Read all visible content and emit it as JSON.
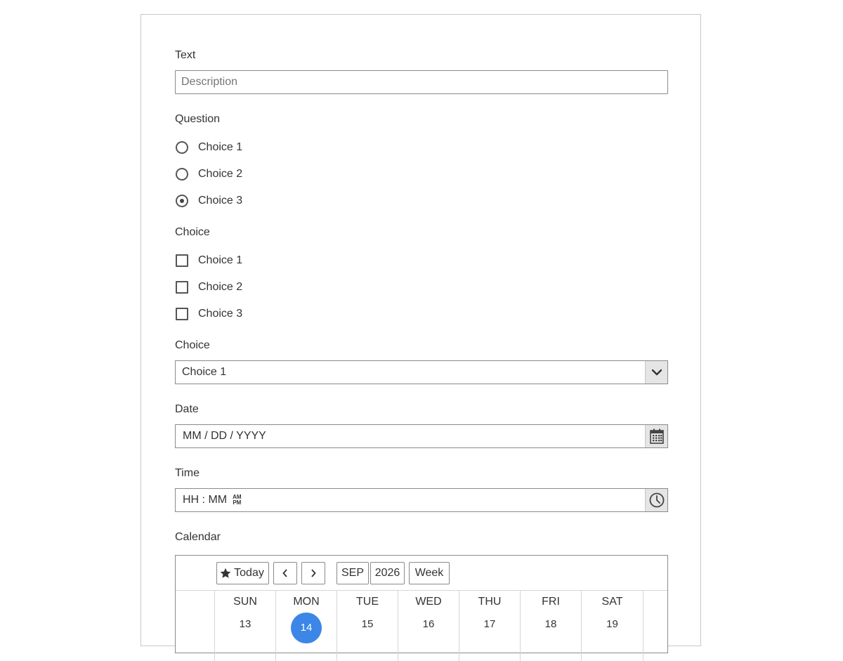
{
  "text_field": {
    "label": "Text",
    "placeholder": "Description"
  },
  "question": {
    "label": "Question",
    "options": [
      "Choice 1",
      "Choice 2",
      "Choice 3"
    ],
    "selected_index": 2
  },
  "checkbox_group": {
    "label": "Choice",
    "options": [
      "Choice 1",
      "Choice 2",
      "Choice 3"
    ]
  },
  "dropdown": {
    "label": "Choice",
    "value": "Choice 1"
  },
  "date": {
    "label": "Date",
    "placeholder": "MM / DD / YYYY"
  },
  "time": {
    "label": "Time",
    "placeholder": "HH : MM",
    "ampm_top": "AM",
    "ampm_bottom": "PM"
  },
  "calendar": {
    "label": "Calendar",
    "today_button": "Today",
    "month": "SEP",
    "year": "2026",
    "view": "Week",
    "days": [
      {
        "name": "SUN",
        "num": "13"
      },
      {
        "name": "MON",
        "num": "14",
        "today": true
      },
      {
        "name": "TUE",
        "num": "15"
      },
      {
        "name": "WED",
        "num": "16"
      },
      {
        "name": "THU",
        "num": "17"
      },
      {
        "name": "FRI",
        "num": "18"
      },
      {
        "name": "SAT",
        "num": "19"
      }
    ]
  },
  "colors": {
    "accent": "#3b86e6",
    "border": "#8a8a8a",
    "side_bg": "#e5e5e5"
  },
  "icons": [
    "chevron-down-icon",
    "calendar-icon",
    "clock-icon",
    "star-icon",
    "chevron-left-icon",
    "chevron-right-icon"
  ]
}
